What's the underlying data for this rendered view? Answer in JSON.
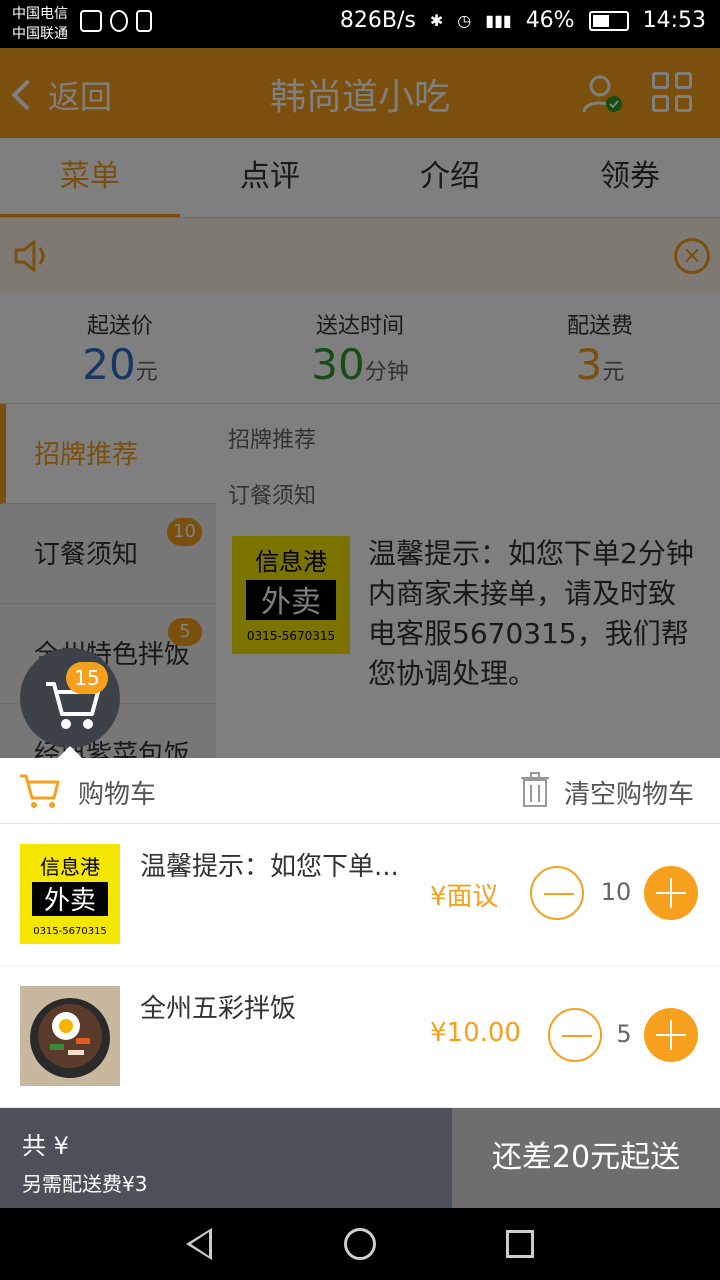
{
  "status_bar": {
    "carrier1": "中国电信",
    "carrier2": "中国联通",
    "speed": "826B/s",
    "battery": "46%",
    "time": "14:53"
  },
  "header": {
    "back_label": "返回",
    "title": "韩尚道小吃"
  },
  "tabs": [
    {
      "label": "菜单"
    },
    {
      "label": "点评"
    },
    {
      "label": "介绍"
    },
    {
      "label": "领券"
    }
  ],
  "info": {
    "min_order_label": "起送价",
    "min_order_value": "20",
    "min_order_unit": "元",
    "delivery_time_label": "送达时间",
    "delivery_time_value": "30",
    "delivery_time_unit": "分钟",
    "delivery_fee_label": "配送费",
    "delivery_fee_value": "3",
    "delivery_fee_unit": "元"
  },
  "sidebar": {
    "items": [
      {
        "label": "招牌推荐",
        "badge": ""
      },
      {
        "label": "订餐须知",
        "badge": "10"
      },
      {
        "label": "全州特色拌饭",
        "badge": "5"
      },
      {
        "label": "经典紫菜包饭",
        "badge": ""
      }
    ]
  },
  "content": {
    "section1": "招牌推荐",
    "section2": "订餐须知",
    "food_desc": "温馨提示：如您下单2分钟内商家未接单，请及时致电客服5670315，我们帮您协调处理。"
  },
  "float_cart": {
    "badge": "15"
  },
  "cart": {
    "header_label": "购物车",
    "clear_label": "清空购物车",
    "items": [
      {
        "name": "温馨提示：如您下单...",
        "price": "¥面议",
        "qty": "10"
      },
      {
        "name": "全州五彩拌饭",
        "price": "¥10.00",
        "qty": "5"
      }
    ]
  },
  "footer": {
    "total": "共 ¥",
    "delivery_note": "另需配送费¥3",
    "checkout_label": "还差20元起送"
  },
  "logo_text": {
    "line1": "信息港",
    "line2": "外卖",
    "line3": "0315-5670315"
  }
}
